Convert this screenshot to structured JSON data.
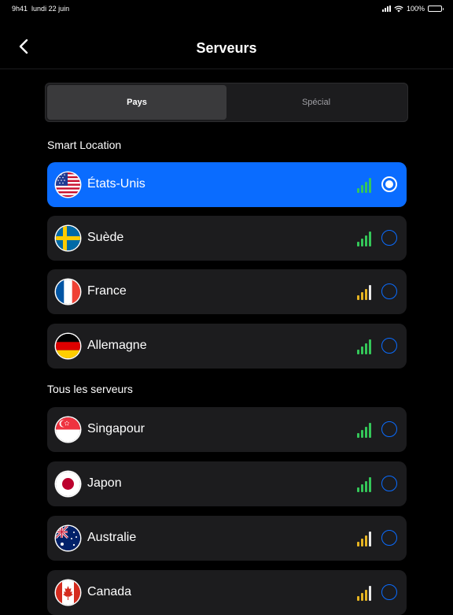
{
  "status_bar": {
    "time": "9h41",
    "date": "lundi 22 juin",
    "battery": "100%"
  },
  "header": {
    "title": "Serveurs",
    "back_icon": "chevron-left-icon"
  },
  "tabs": [
    {
      "label": "Pays",
      "active": true
    },
    {
      "label": "Spécial",
      "active": false
    }
  ],
  "sections": [
    {
      "title": "Smart Location",
      "items": [
        {
          "label": "États-Unis",
          "flag": "us-flag-icon",
          "signal_level": 4,
          "signal_color": "#34c759",
          "selected": true
        },
        {
          "label": "Suède",
          "flag": "sweden-flag-icon",
          "signal_level": 4,
          "signal_color": "#34c759",
          "selected": false
        },
        {
          "label": "France",
          "flag": "france-flag-icon",
          "signal_level": 3,
          "signal_color": "#e6b422",
          "selected": false
        },
        {
          "label": "Allemagne",
          "flag": "germany-flag-icon",
          "signal_level": 4,
          "signal_color": "#34c759",
          "selected": false
        }
      ]
    },
    {
      "title": "Tous les serveurs",
      "items": [
        {
          "label": "Singapour",
          "flag": "singapore-flag-icon",
          "signal_level": 4,
          "signal_color": "#34c759",
          "selected": false
        },
        {
          "label": "Japon",
          "flag": "japan-flag-icon",
          "signal_level": 4,
          "signal_color": "#34c759",
          "selected": false
        },
        {
          "label": "Australie",
          "flag": "australia-flag-icon",
          "signal_level": 3,
          "signal_color": "#e6b422",
          "selected": false
        },
        {
          "label": "Canada",
          "flag": "canada-flag-icon",
          "signal_level": 3,
          "signal_color": "#e6b422",
          "selected": false
        }
      ]
    }
  ],
  "colors": {
    "accent": "#0a6cff",
    "signal_good": "#34c759",
    "signal_medium": "#e6b422",
    "row_bg": "#1c1c1e"
  }
}
